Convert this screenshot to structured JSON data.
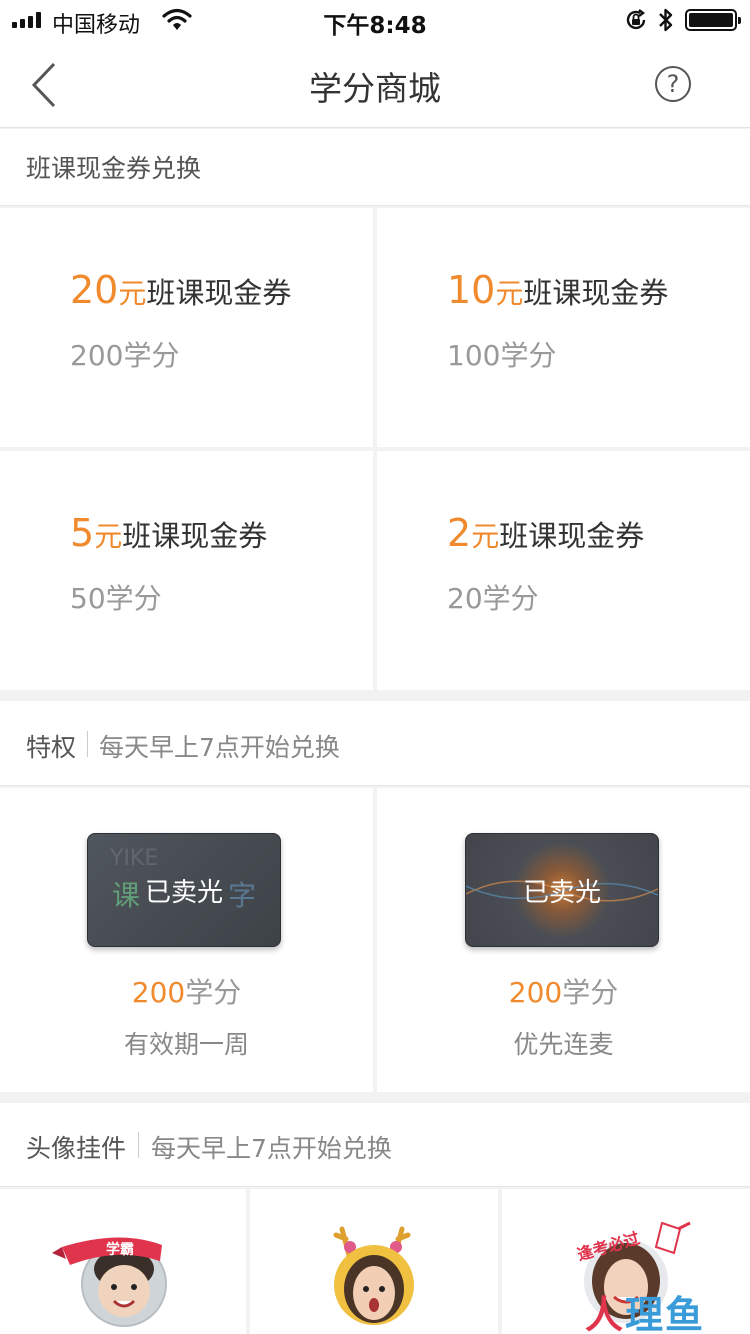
{
  "status_bar": {
    "carrier": "中国移动",
    "time": "下午8:48",
    "icons": [
      "signal-icon",
      "wifi-icon",
      "orientation-lock-icon",
      "bluetooth-icon",
      "battery-icon"
    ]
  },
  "nav": {
    "title": "学分商城",
    "back_icon": "back-chevron-icon",
    "help_icon": "help-icon",
    "help_glyph": "?"
  },
  "voucher_section": {
    "title": "班课现金券兑换",
    "items": [
      {
        "amount": "20",
        "unit": "元",
        "name": "班课现金券",
        "points": "200学分"
      },
      {
        "amount": "10",
        "unit": "元",
        "name": "班课现金券",
        "points": "100学分"
      },
      {
        "amount": "5",
        "unit": "元",
        "name": "班课现金券",
        "points": "50学分"
      },
      {
        "amount": "2",
        "unit": "元",
        "name": "班课现金券",
        "points": "20学分"
      }
    ]
  },
  "privilege_section": {
    "title": "特权",
    "note": "每天早上7点开始兑换",
    "items": [
      {
        "thumb_text_top": "YIKE",
        "thumb_text": "课",
        "thumb_text_right": "字",
        "status": "已卖光",
        "points": "200",
        "points_suffix": "学分",
        "desc": "有效期一周"
      },
      {
        "status": "已卖光",
        "points": "200",
        "points_suffix": "学分",
        "desc": "优先连麦"
      }
    ]
  },
  "avatar_section": {
    "title": "头像挂件",
    "note": "每天早上7点开始兑换",
    "items": [
      {
        "badge_text": "学霸"
      },
      {
        "badge_text": ""
      },
      {
        "badge_text": "逢考必过"
      }
    ]
  },
  "watermark": {
    "text_left": "人",
    "text_right": "理鱼"
  },
  "colors": {
    "accent": "#f08a2d",
    "background": "#f2f2f2",
    "card": "#ffffff"
  }
}
